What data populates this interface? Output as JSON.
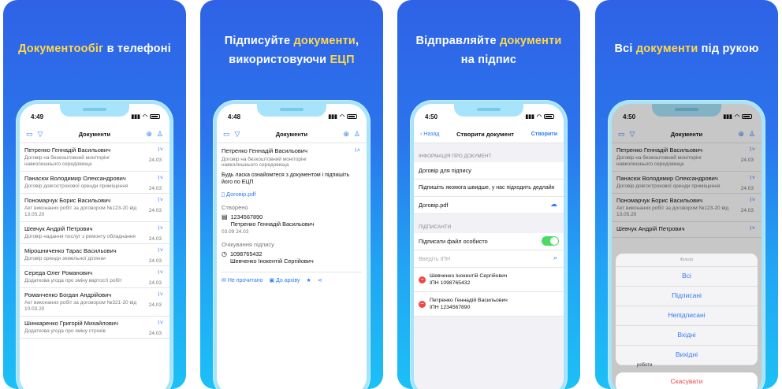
{
  "panel1": {
    "headline": "Документообіг в телефоні",
    "time": "4:49",
    "screen_title": "Документи",
    "rows": [
      {
        "name": "Петренко Геннадій Васильович",
        "desc": "Договір на безкоштовний моніторінг навколишнього середовища",
        "date": "24.03"
      },
      {
        "name": "Панасюк Володимир Олександрович",
        "desc": "Договір довгострокової оренди приміщення",
        "date": "24.03"
      },
      {
        "name": "Пономарчук Борис Васильович",
        "desc": "Акт виконаних робіт за договором №123-20 від 13.05.20",
        "date": "24.03"
      },
      {
        "name": "Шевчук Андрій Петрович",
        "desc": "Договір надання послуг з ремонту обладнання",
        "date": "24.03"
      },
      {
        "name": "Мірошниченко Тарас Васильович",
        "desc": "Договір оренди земельної ділянки",
        "date": "24.03"
      },
      {
        "name": "Середа Олег Романович",
        "desc": "Додаткова угода про зміну вартості робіт",
        "date": "24.03"
      },
      {
        "name": "Романченко Богдан Андрійович",
        "desc": "Акт виконаних робіт за договором №321-20 від 10.03.20",
        "date": "24.03"
      },
      {
        "name": "Шинкаренко Григорій Михайлович",
        "desc": "Додаткова угода про зміну строків",
        "date": "24.03"
      }
    ]
  },
  "panel2": {
    "headline_pre": "Підписуйте ",
    "headline_hl": "документи",
    "headline_post": ",",
    "headline_line2_pre": "використовуючи ",
    "headline_line2_hl": "ЕЦП",
    "time": "4:48",
    "screen_title": "Документи",
    "name": "Петренко Геннадій Васильович",
    "desc": "Договір на безкоштовний моніторінг навколишнього середовища",
    "note": "Будь ласка ознайомтеся з документом і підпишіть його по ЕЦП",
    "file": "Договір.pdf",
    "created_label": "Створено",
    "created_code": "1234567890",
    "created_name": "Петренко Геннадій Васильович",
    "created_date": "03.09 24.03",
    "waiting_label": "Очікування підпису",
    "waiting_code": "1098765432",
    "waiting_name": "Шевченко Інокентій Сергійович",
    "action_unread": "Не прочитано",
    "action_archive": "До архіву"
  },
  "panel3": {
    "headline_pre": "Відправляйте ",
    "headline_hl": "документи",
    "headline_line2": "на підпис",
    "time": "4:50",
    "back": "Назад",
    "screen_title": "Створити документ",
    "create": "Створити",
    "info_label": "ІНФОРМАЦІЯ ПРО ДОКУМЕНТ",
    "doc_title": "Договір для підпису",
    "doc_note": "Підпишіть якомога швидше, у нас підходить дедлайн",
    "file": "Договір.pdf",
    "signers_label": "ПІДПИСАНТИ",
    "sign_self": "Підписати файл особисто",
    "ipn_placeholder": "Введіть ІПН",
    "signers": [
      {
        "name": "Шевченко Інокентій Сергійович",
        "ipn": "ІПН 1098765432"
      },
      {
        "name": "Петренко Геннадій Васильович",
        "ipn": "ІПН 1234567890"
      }
    ]
  },
  "panel4": {
    "headline_pre": "Всі ",
    "headline_hl": "документи",
    "headline_post": " під рукою",
    "time": "4:50",
    "screen_title": "Документи",
    "rows": [
      {
        "name": "Петренко Геннадій Васильович",
        "desc": "Договір на безкоштовний моніторінг навколишнього середовища",
        "date": "24.03"
      },
      {
        "name": "Панасюк Володимир Олександрович",
        "desc": "Договір довгострокової оренди приміщення",
        "date": "24.03"
      },
      {
        "name": "Пономарчук Борис Васильович",
        "desc": "Акт виконаних робіт за договором №123-20 від 13.05.20",
        "date": "24.03"
      },
      {
        "name": "Шевчук Андрій Петрович",
        "desc": "",
        "date": ""
      }
    ],
    "sheet_title": "Фільтр",
    "options": [
      "Всі",
      "Підписані",
      "Непідписані",
      "Вхідні",
      "Вихідні"
    ],
    "peek_text": "роботи",
    "cancel": "Скасувати"
  },
  "colors": {
    "accent": "#2f7bf6",
    "highlight": "#ffd84a",
    "toggle": "#4cd964",
    "danger": "#f04848"
  }
}
